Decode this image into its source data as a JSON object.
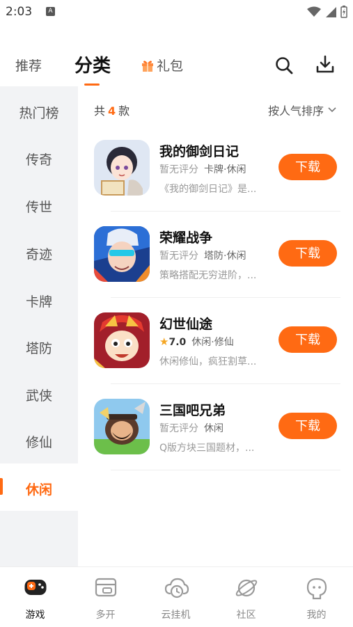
{
  "status": {
    "time": "2:03",
    "notif_glyph": "A"
  },
  "top_tabs": [
    {
      "label": "推荐"
    },
    {
      "label": "分类"
    },
    {
      "label": "礼包"
    }
  ],
  "sidebar": {
    "items": [
      {
        "label": "热门榜"
      },
      {
        "label": "传奇"
      },
      {
        "label": "传世"
      },
      {
        "label": "奇迹"
      },
      {
        "label": "卡牌"
      },
      {
        "label": "塔防"
      },
      {
        "label": "武侠"
      },
      {
        "label": "修仙"
      },
      {
        "label": "休闲"
      }
    ],
    "active_index": 8
  },
  "content": {
    "count_prefix": "共",
    "count_value": "4",
    "count_suffix": "款",
    "sort_label": "按人气排序"
  },
  "games": [
    {
      "name": "我的御剑日记",
      "rating": "暂无评分",
      "tags": "卡牌·休闲",
      "desc": "《我的御剑日记》是...",
      "button": "下载"
    },
    {
      "name": "荣耀战争",
      "rating": "暂无评分",
      "tags": "塔防·休闲",
      "desc": "策略搭配无穷进阶，...",
      "button": "下载"
    },
    {
      "name": "幻世仙途",
      "rating": "7.0",
      "tags": "休闲·修仙",
      "desc": "休闲修仙，疯狂割草...",
      "button": "下载"
    },
    {
      "name": "三国吧兄弟",
      "rating": "暂无评分",
      "tags": "休闲",
      "desc": "Q版方块三国题材，...",
      "button": "下载"
    }
  ],
  "bottom_nav": [
    {
      "label": "游戏",
      "icon": "gamepad-icon"
    },
    {
      "label": "多开",
      "icon": "multi-open-icon"
    },
    {
      "label": "云挂机",
      "icon": "cloud-clock-icon"
    },
    {
      "label": "社区",
      "icon": "planet-icon"
    },
    {
      "label": "我的",
      "icon": "profile-icon"
    }
  ],
  "colors": {
    "accent": "#ff6a13",
    "sidebar_bg": "#f2f3f5"
  }
}
